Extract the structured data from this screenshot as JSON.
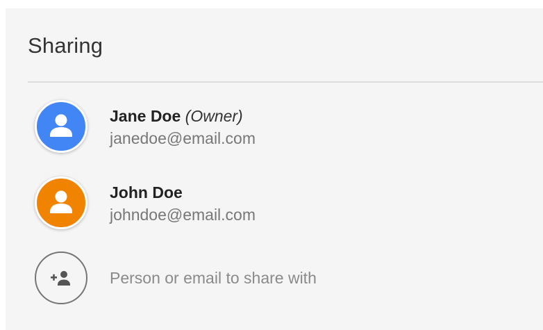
{
  "header": {
    "title": "Sharing"
  },
  "people": [
    {
      "name": "Jane Doe",
      "role": "(Owner)",
      "email": "janedoe@email.com",
      "avatar_color": "#4285f4"
    },
    {
      "name": "John Doe",
      "role": "",
      "email": "johndoe@email.com",
      "avatar_color": "#f08300"
    }
  ],
  "add_person": {
    "icon": "person-add-icon",
    "placeholder": "Person or email to share with"
  },
  "colors": {
    "panel_background": "#f5f5f5",
    "divider": "#dcdcdc"
  }
}
